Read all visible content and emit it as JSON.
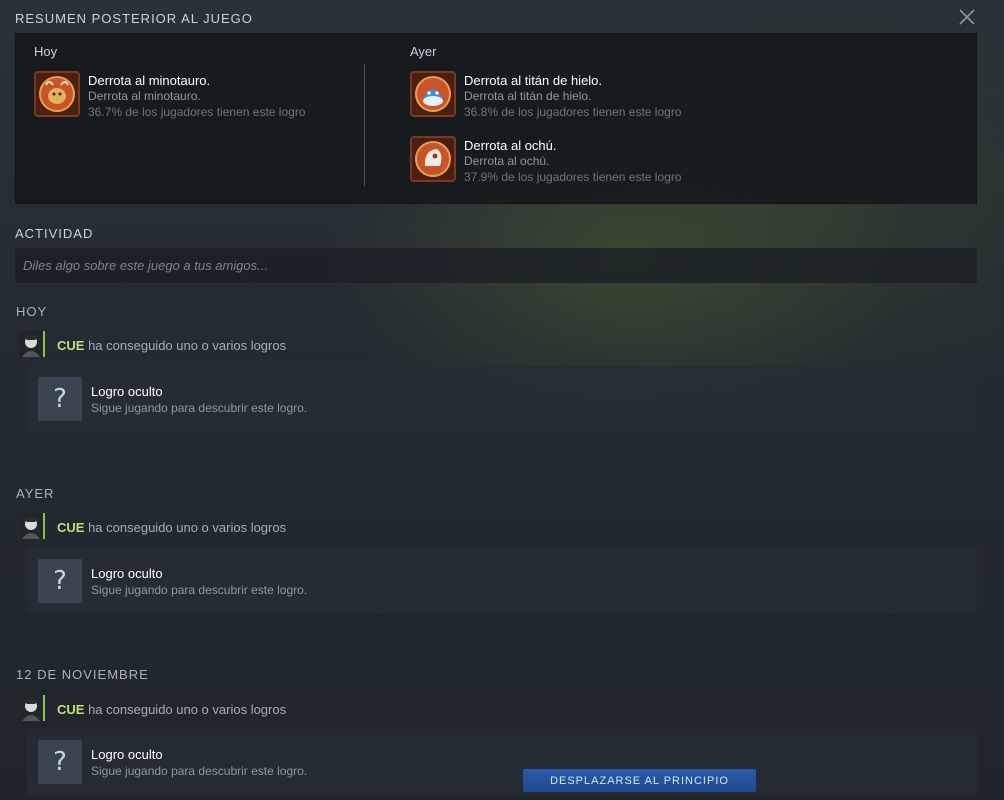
{
  "header": {
    "title": "RESUMEN POSTERIOR AL JUEGO"
  },
  "summary": {
    "today": {
      "label": "Hoy",
      "achievements": [
        {
          "name": "Derrota al minotauro.",
          "desc": "Derrota al minotauro.",
          "pct": "36.7% de los jugadores tienen este logro",
          "icon": "minotaur-badge-icon"
        }
      ]
    },
    "yesterday": {
      "label": "Ayer",
      "achievements": [
        {
          "name": "Derrota al titán de hielo.",
          "desc": "Derrota al titán de hielo.",
          "pct": "36.8% de los jugadores tienen este logro",
          "icon": "ice-titan-badge-icon"
        },
        {
          "name": "Derrota al ochú.",
          "desc": "Derrota al ochú.",
          "pct": "37.9% de los jugadores tienen este logro",
          "icon": "ochu-badge-icon"
        }
      ]
    }
  },
  "activity": {
    "title": "ACTIVIDAD",
    "placeholder": "Diles algo sobre este juego a tus amigos...",
    "groups": [
      {
        "day": "HOY",
        "user": "CUE",
        "verb": "ha conseguido uno o varios logros",
        "card": {
          "symbol": "?",
          "title": "Logro oculto",
          "desc": "Sigue jugando para descubrir este logro."
        }
      },
      {
        "day": "AYER",
        "user": "CUE",
        "verb": "ha conseguido uno o varios logros",
        "card": {
          "symbol": "?",
          "title": "Logro oculto",
          "desc": "Sigue jugando para descubrir este logro."
        }
      },
      {
        "day": "12 DE NOVIEMBRE",
        "user": "CUE",
        "verb": "ha conseguido uno o varios logros",
        "card": {
          "symbol": "?",
          "title": "Logro oculto",
          "desc": "Sigue jugando para descubrir este logro."
        }
      }
    ]
  },
  "scroll_top_label": "DESPLAZARSE AL PRINCIPIO",
  "colors": {
    "accent_green": "#8bc53f",
    "username": "#c2e07c",
    "button_blue": "#2a5aa8"
  }
}
